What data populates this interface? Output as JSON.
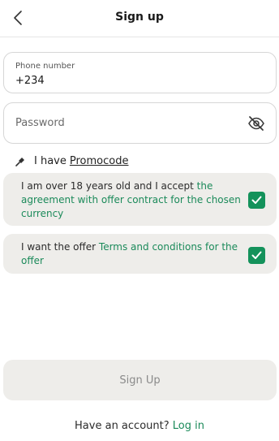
{
  "header": {
    "title": "Sign up",
    "back_icon": "chevron-left-icon"
  },
  "form": {
    "phone": {
      "label": "Phone number",
      "value": "+234"
    },
    "password": {
      "placeholder": "Password",
      "toggle_icon": "eye-slash-icon"
    },
    "promocode": {
      "prefix": "I have",
      "link": "Promocode",
      "icon": "pin-icon"
    }
  },
  "consents": [
    {
      "text_before": "I am over 18 years old and I accept ",
      "link_text": "the agreement with offer contract for the chosen currency",
      "checked": true
    },
    {
      "text_before": "I want the offer ",
      "link_text": "Terms and conditions for the offer",
      "checked": true
    }
  ],
  "actions": {
    "signup_label": "Sign Up",
    "have_account": "Have an account?",
    "login_label": "Log in"
  },
  "colors": {
    "accent": "#14925b",
    "card_bg": "#eeedea",
    "disabled_text": "#8a8a8a"
  }
}
